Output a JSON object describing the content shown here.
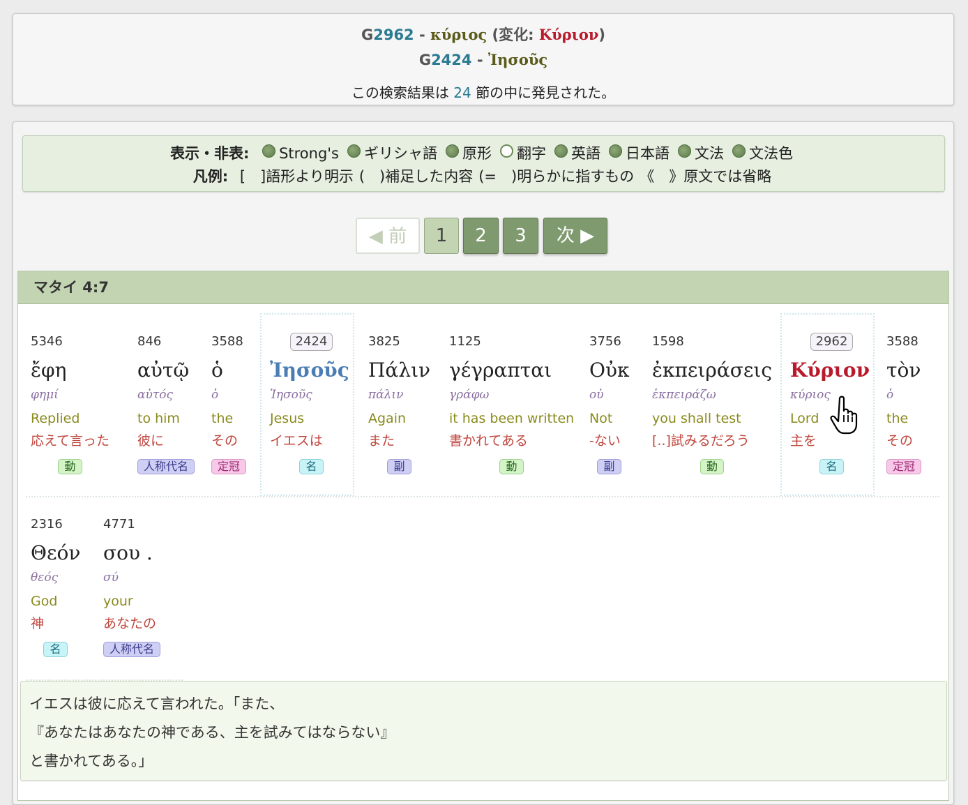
{
  "header": {
    "line1": {
      "prefix": "G",
      "num": "2962",
      "dash": " - ",
      "word": "κύριος",
      "var_open": " (変化: ",
      "var_word": "Κύριον",
      "var_close": ")"
    },
    "line2": {
      "prefix": "G",
      "num": "2424",
      "dash": " - ",
      "word": "Ἰησοῦς"
    },
    "line3": {
      "before": "この検索結果は ",
      "count": "24",
      "after": " 節の中に発見された。"
    }
  },
  "toggles": {
    "label": "表示・非表:",
    "items": [
      {
        "label": "Strong's",
        "on": true
      },
      {
        "label": "ギリシャ語",
        "on": true
      },
      {
        "label": "原形",
        "on": true
      },
      {
        "label": "翻字",
        "on": false
      },
      {
        "label": "英語",
        "on": true
      },
      {
        "label": "日本語",
        "on": true
      },
      {
        "label": "文法",
        "on": true
      },
      {
        "label": "文法色",
        "on": true
      }
    ],
    "legend_label": "凡例:",
    "legend": [
      {
        "mark": "[　]",
        "text": "語形より明示"
      },
      {
        "mark": "(　)",
        "text": "補足した内容"
      },
      {
        "mark": "(=　)",
        "text": "明らかに指すもの"
      },
      {
        "mark": "《　》",
        "text": "原文では省略"
      }
    ]
  },
  "pager": {
    "prev": "◀ 前",
    "current": "1",
    "pages": [
      "2",
      "3"
    ],
    "next": "次 ▶"
  },
  "verse": {
    "reference": "マタイ 4:7",
    "words": [
      {
        "strong": "5346",
        "greek": "ἔφη",
        "lemma": "φημί",
        "english": "Replied",
        "japanese": "応えて言った",
        "pos": "動",
        "pos_type": "verb",
        "highlight": ""
      },
      {
        "strong": "846",
        "greek": "αὐτῷ",
        "lemma": "αὐτός",
        "english": "to him",
        "japanese": "彼に",
        "pos": "人称代名",
        "pos_type": "pron",
        "highlight": ""
      },
      {
        "strong": "3588",
        "greek": "ὁ",
        "lemma": "ὁ",
        "english": "the",
        "japanese": "その",
        "pos": "定冠",
        "pos_type": "art",
        "highlight": ""
      },
      {
        "strong": "2424",
        "greek": "Ἰησοῦς",
        "lemma": "Ἰησοῦς",
        "english": "Jesus",
        "japanese": "イエスは",
        "pos": "名",
        "pos_type": "noun",
        "highlight": "blue"
      },
      {
        "strong": "3825",
        "greek": "Πάλιν",
        "lemma": "πάλιν",
        "english": "Again",
        "japanese": "また",
        "pos": "副",
        "pos_type": "adv",
        "highlight": ""
      },
      {
        "strong": "1125",
        "greek": "γέγραπται",
        "lemma": "γράφω",
        "english": "it has been written",
        "japanese": "書かれてある",
        "pos": "動",
        "pos_type": "verb",
        "highlight": ""
      },
      {
        "strong": "3756",
        "greek": "Οὐκ",
        "lemma": "οὐ",
        "english": "Not",
        "japanese": "-ない",
        "pos": "副",
        "pos_type": "adv",
        "highlight": ""
      },
      {
        "strong": "1598",
        "greek": "ἐκπειράσεις",
        "lemma": "ἐκπειράζω",
        "english": "you shall test",
        "japanese": "[..]試みるだろう",
        "pos": "動",
        "pos_type": "verb",
        "highlight": ""
      },
      {
        "strong": "2962",
        "greek": "Κύριον",
        "lemma": "κύριος",
        "english": "Lord",
        "japanese": "主を",
        "pos": "名",
        "pos_type": "noun",
        "highlight": "red"
      },
      {
        "strong": "3588",
        "greek": "τὸν",
        "lemma": "ὁ",
        "english": "the",
        "japanese": "その",
        "pos": "定冠",
        "pos_type": "art",
        "highlight": ""
      },
      {
        "strong": "2316",
        "greek": "Θεόν",
        "lemma": "θεός",
        "english": "God",
        "japanese": "神",
        "pos": "名",
        "pos_type": "noun",
        "highlight": ""
      },
      {
        "strong": "4771",
        "greek": "σου .",
        "lemma": "σύ",
        "english": "your",
        "japanese": "あなたの",
        "pos": "人称代名",
        "pos_type": "pron",
        "highlight": ""
      }
    ],
    "translation": [
      "イエスは彼に応えて言われた。「また、",
      "『あなたはあなたの神である、主を試みてはならない』",
      "と書かれてある。」"
    ]
  },
  "cursor": "hand-pointer-icon"
}
